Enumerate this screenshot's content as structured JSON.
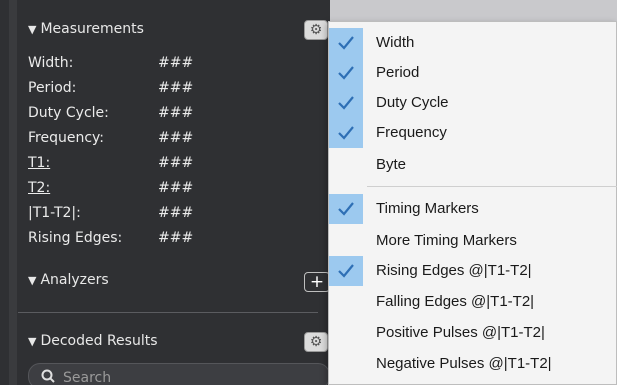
{
  "measurements": {
    "title": "Measurements",
    "rows": [
      {
        "label": "Width:",
        "value": "###"
      },
      {
        "label": "Period:",
        "value": "###"
      },
      {
        "label": "Duty Cycle:",
        "value": "###"
      },
      {
        "label": "Frequency:",
        "value": "###"
      },
      {
        "label": "T1:",
        "value": "###"
      },
      {
        "label": "T2:",
        "value": "###"
      },
      {
        "label": "|T1-T2|:",
        "value": "###"
      },
      {
        "label": "Rising Edges:",
        "value": "###"
      }
    ]
  },
  "analyzers": {
    "title": "Analyzers",
    "add_label": "+"
  },
  "decoded_results": {
    "title": "Decoded Results"
  },
  "search": {
    "placeholder": "Search"
  },
  "menu": {
    "items": [
      {
        "label": "Width",
        "checked": true
      },
      {
        "label": "Period",
        "checked": true
      },
      {
        "label": "Duty Cycle",
        "checked": true
      },
      {
        "label": "Frequency",
        "checked": true
      },
      {
        "label": "Byte",
        "checked": false
      },
      {
        "label": "Timing Markers",
        "checked": true
      },
      {
        "label": "More Timing Markers",
        "checked": false
      },
      {
        "label": "Rising Edges @|T1-T2|",
        "checked": true
      },
      {
        "label": "Falling Edges @|T1-T2|",
        "checked": false
      },
      {
        "label": "Positive Pulses @|T1-T2|",
        "checked": false
      },
      {
        "label": "Negative Pulses @|T1-T2|",
        "checked": false
      }
    ]
  },
  "colors": {
    "panel": "#2f3033",
    "check_highlight": "#9cc9ef",
    "menu_bg": "#f4f4f4"
  }
}
